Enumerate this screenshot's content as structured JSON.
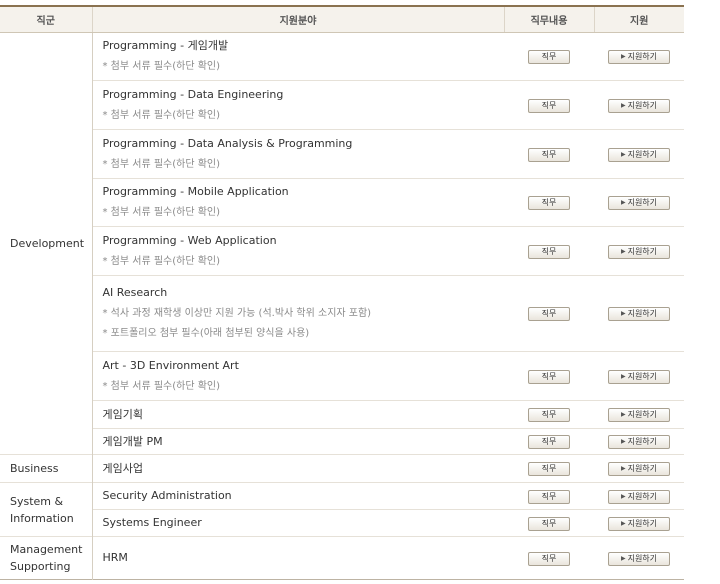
{
  "header": {
    "category": "직군",
    "field": "지원분야",
    "duty": "직무내용",
    "apply": "지원"
  },
  "buttons": {
    "duty_label": "직무",
    "apply_label": "지원하기",
    "apply_arrow": "▶"
  },
  "categories": {
    "development": "Development",
    "business": "Business",
    "system_line1": "System &",
    "system_line2": "Information",
    "management_line1": "Management",
    "management_line2": "Supporting"
  },
  "positions": [
    {
      "title": "Programming - 게임개발",
      "notes": [
        "* 첨부 서류 필수(하단 확인)"
      ]
    },
    {
      "title": "Programming - Data Engineering",
      "notes": [
        "* 첨부 서류 필수(하단 확인)"
      ]
    },
    {
      "title": "Programming - Data Analysis & Programming",
      "notes": [
        "* 첨부 서류 필수(하단 확인)"
      ]
    },
    {
      "title": "Programming - Mobile Application",
      "notes": [
        "* 첨부 서류 필수(하단 확인)"
      ]
    },
    {
      "title": "Programming - Web Application",
      "notes": [
        "* 첨부 서류 필수(하단 확인)"
      ]
    },
    {
      "title": "AI Research",
      "notes": [
        "* 석사 과정 재학생 이상만 지원 가능 (석.박사 학위 소지자 포함)",
        "* 포트폴리오 첨부 필수(아래 첨부된 양식을 사용)"
      ]
    },
    {
      "title": "Art - 3D Environment Art",
      "notes": [
        "* 첨부 서류 필수(하단 확인)"
      ]
    },
    {
      "title": "게임기획",
      "notes": []
    },
    {
      "title": "게임개발 PM",
      "notes": []
    },
    {
      "title": "게임사업",
      "notes": []
    },
    {
      "title": "Security Administration",
      "notes": []
    },
    {
      "title": "Systems Engineer",
      "notes": []
    },
    {
      "title": "HRM",
      "notes": []
    }
  ]
}
